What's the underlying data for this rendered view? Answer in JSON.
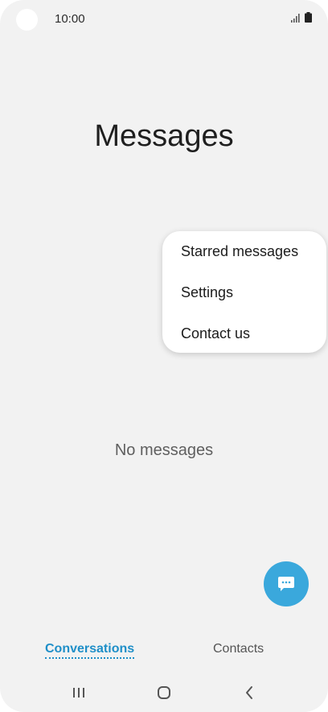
{
  "status_bar": {
    "time": "10:00",
    "icons": [
      "signal-icon",
      "battery-icon"
    ]
  },
  "app": {
    "title": "Messages"
  },
  "menu": {
    "items": [
      {
        "label": "Starred messages"
      },
      {
        "label": "Settings"
      },
      {
        "label": "Contact us"
      }
    ]
  },
  "main": {
    "empty_text": "No messages"
  },
  "fab": {
    "icon": "chat-bubble-icon"
  },
  "tabs": [
    {
      "label": "Conversations",
      "active": true
    },
    {
      "label": "Contacts",
      "active": false
    }
  ],
  "nav": {
    "icons": [
      "recent-apps-icon",
      "home-icon",
      "back-icon"
    ]
  },
  "colors": {
    "accent": "#3aa8dc",
    "active_tab": "#1f8fc8",
    "background": "#f2f2f2"
  }
}
